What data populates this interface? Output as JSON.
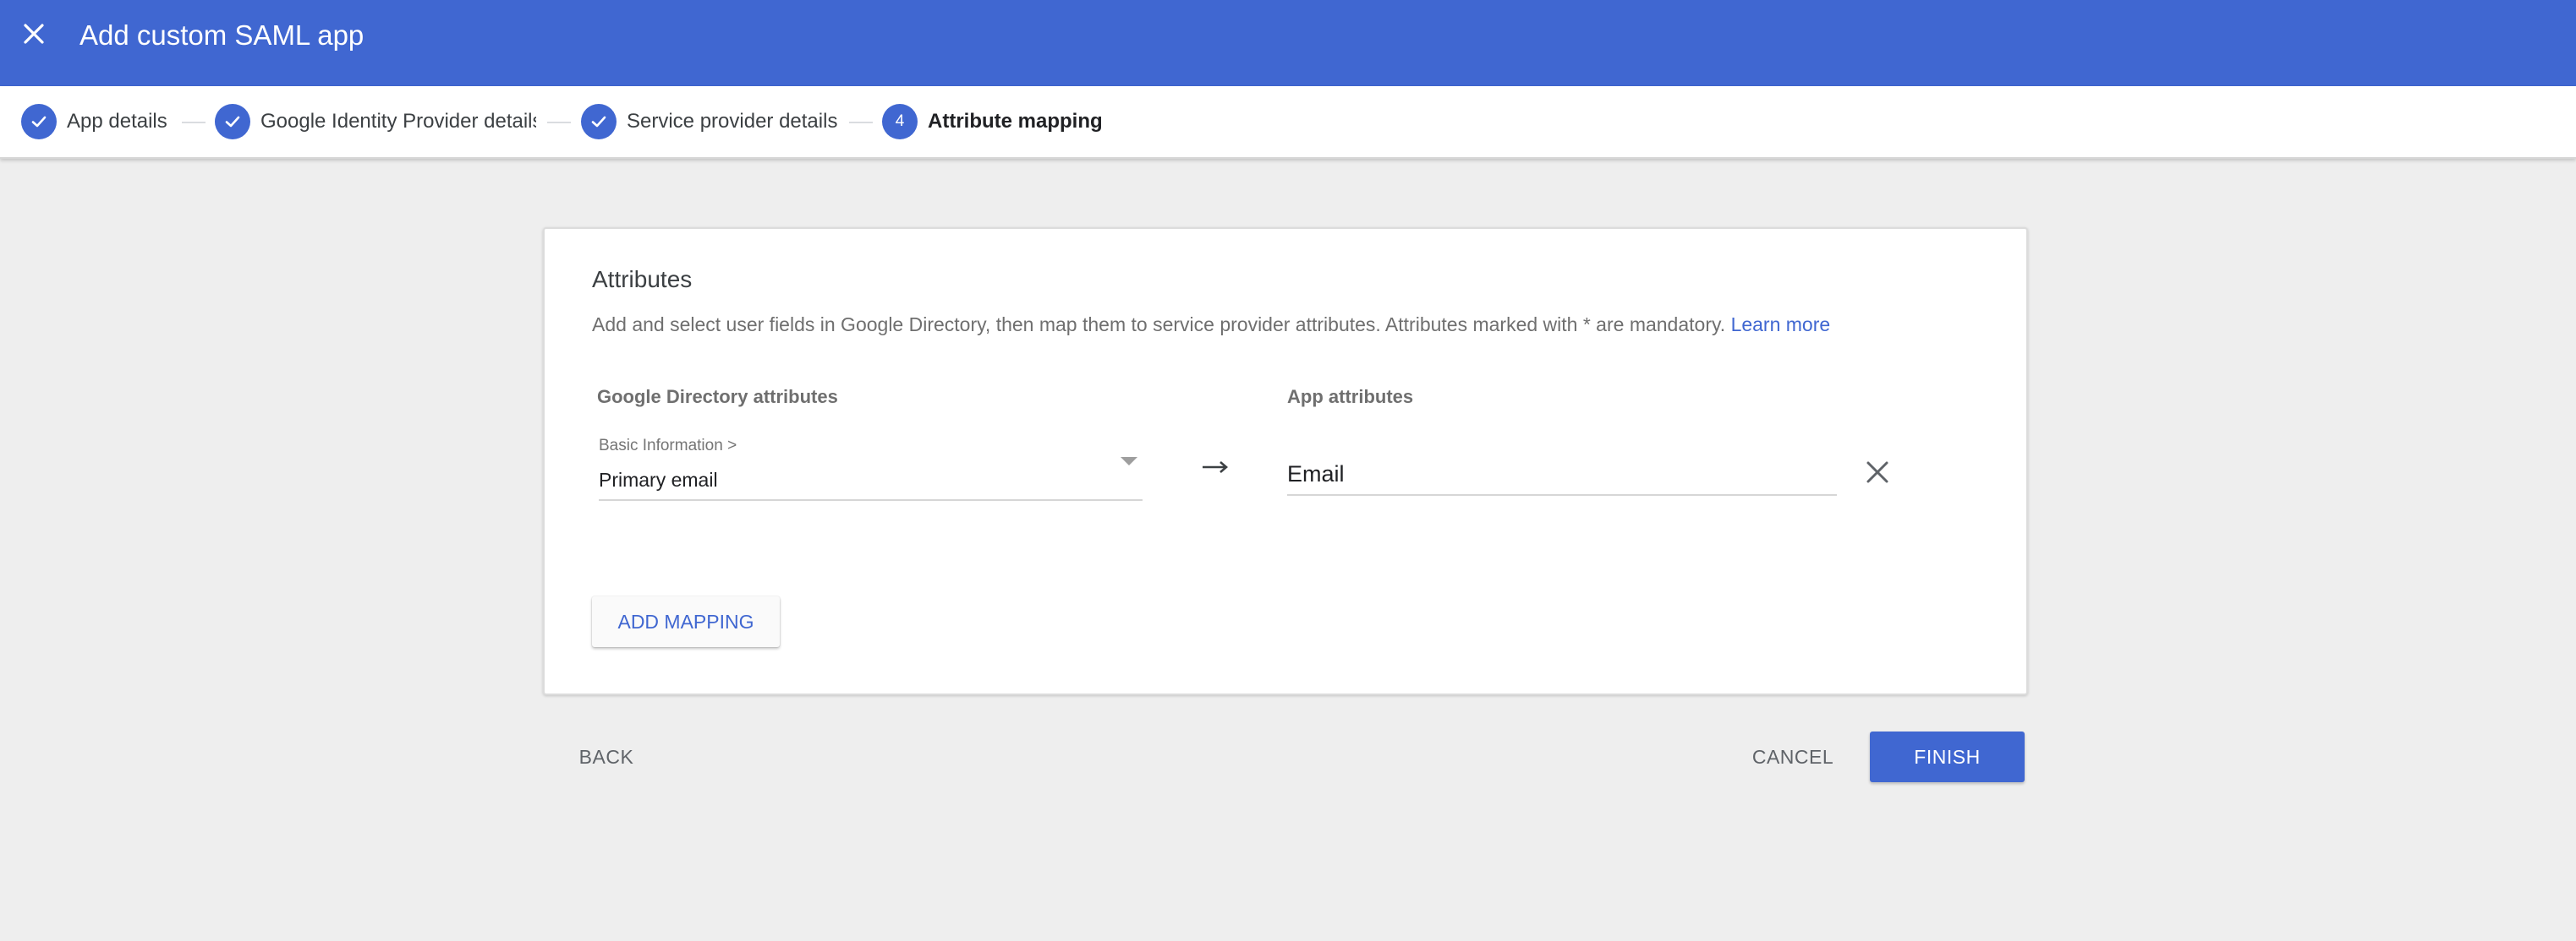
{
  "header": {
    "title": "Add custom SAML app",
    "close_icon": "close-icon",
    "background_color": "#4067d1"
  },
  "stepper": {
    "steps": [
      {
        "label": "App details",
        "state": "done",
        "icon": "check-icon"
      },
      {
        "label": "Google Identity Provider details",
        "state": "done",
        "icon": "check-icon"
      },
      {
        "label": "Service provider details",
        "state": "done",
        "icon": "check-icon"
      },
      {
        "label": "Attribute mapping",
        "state": "active",
        "number": "4"
      }
    ]
  },
  "card": {
    "title": "Attributes",
    "description": "Add and select user fields in Google Directory, then map them to service provider attributes. Attributes marked with * are mandatory.",
    "learn_more": "Learn more",
    "google_col_header": "Google Directory attributes",
    "app_col_header": "App attributes",
    "mapping": {
      "category": "Basic Information >",
      "selected": "Primary email",
      "app_attribute": "Email"
    },
    "add_mapping_label": "ADD MAPPING"
  },
  "footer": {
    "back_label": "BACK",
    "cancel_label": "CANCEL",
    "finish_label": "FINISH"
  },
  "colors": {
    "accent": "#4067d1",
    "page_background": "#eeeeee"
  }
}
